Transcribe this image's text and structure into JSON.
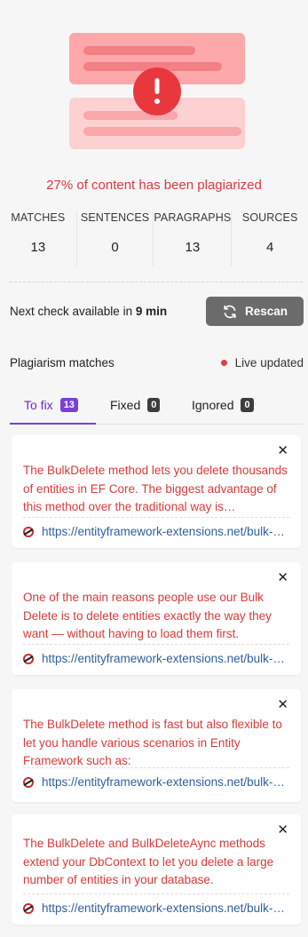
{
  "summary": {
    "headline": "27% of content has been plagiarized"
  },
  "stats": [
    {
      "label": "MATCHES",
      "value": "13"
    },
    {
      "label": "SENTENCES",
      "value": "0"
    },
    {
      "label": "PARAGRAPHS",
      "value": "13"
    },
    {
      "label": "SOURCES",
      "value": "4"
    }
  ],
  "recheck": {
    "prefix": "Next check available in ",
    "time": "9 min",
    "button_label": "Rescan"
  },
  "matches_header": {
    "title": "Plagiarism matches",
    "live_label": "Live updated"
  },
  "tabs": [
    {
      "label": "To fix",
      "count": "13"
    },
    {
      "label": "Fixed",
      "count": "0"
    },
    {
      "label": "Ignored",
      "count": "0"
    }
  ],
  "cards": [
    {
      "text": "The BulkDelete method lets you delete thousands of entities in EF Core. The biggest advantage of this method over the traditional way is performance.",
      "url": "https://entityframework-extensions.net/bulk-delete"
    },
    {
      "text": "One of the main reasons people use our Bulk Delete is to delete entities exactly the way they want — without having to load them first.",
      "url": "https://entityframework-extensions.net/bulk-delete"
    },
    {
      "text": "The BulkDelete method is fast but also flexible to let you handle various scenarios in Entity Framework such as:",
      "url": "https://entityframework-extensions.net/bulk-delete"
    },
    {
      "text": "The BulkDelete and BulkDeleteAync methods extend your DbContext to let you delete a large number of entities in your database.",
      "url": "https://entityframework-extensions.net/bulk-delete"
    }
  ],
  "colors": {
    "alert": "#d93a3a",
    "accent": "#7b3fd6",
    "link": "#2f5f9e"
  }
}
